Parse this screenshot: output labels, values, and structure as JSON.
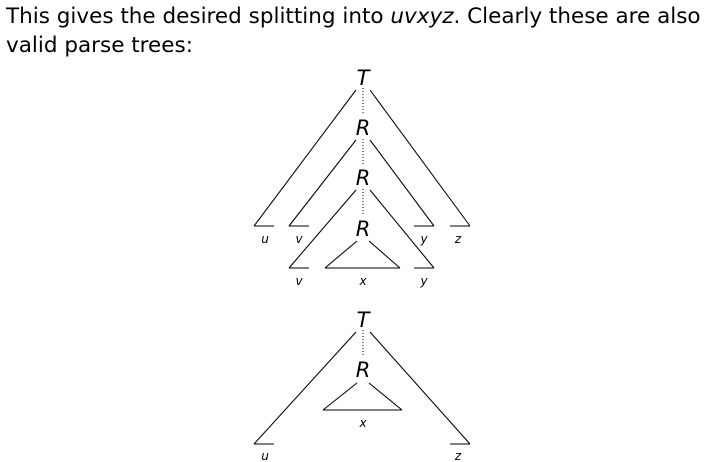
{
  "paragraph": {
    "part1": "This gives the desired splitting into ",
    "word": "uvxyz",
    "part2": ". Clearly these are also valid parse trees:"
  },
  "tree1": {
    "root": "T",
    "r1": "R",
    "r2": "R",
    "r3": "R",
    "u": "u",
    "v_outer": "v",
    "y_outer": "y",
    "z": "z",
    "v_inner": "v",
    "x": "x",
    "y_inner": "y"
  },
  "tree2": {
    "root": "T",
    "r1": "R",
    "u": "u",
    "x": "x",
    "z": "z"
  }
}
